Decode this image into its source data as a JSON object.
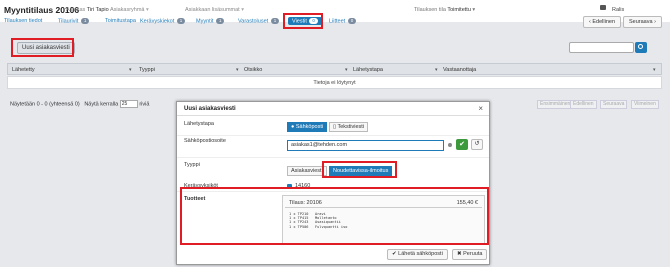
{
  "header": {
    "title": "Myyntitilaus 20106",
    "customer_label": "Asiakas",
    "customer_value": "Tiri Tapio",
    "customer_suffix": "Asiakasryhmä",
    "extra_label": "Asiakkaan lisäsummat",
    "status_label": "Tilauksen tila",
    "status_value": "Toimitettu",
    "user_label": "Ralis",
    "prev_button": "Edellinen",
    "next_button": "Seuraava"
  },
  "tabs": [
    {
      "label": "Tilauksen tiedot"
    },
    {
      "label": "Tilaurivit",
      "badge": "1"
    },
    {
      "label": "Toimitustapa"
    },
    {
      "label": "Kerävyskiekot",
      "badge": "1"
    },
    {
      "label": "Myyntit",
      "badge": "1"
    },
    {
      "label": "Varastoluset",
      "badge": "1"
    },
    {
      "label": "Viestit",
      "badge": "0"
    },
    {
      "label": "Liitteet",
      "badge": "0"
    }
  ],
  "main": {
    "new_message_button": "Uusi asiakasviesti",
    "columns": [
      "Lähetetty",
      "Tyyppi",
      "Otsikko",
      "Lähetystapa",
      "Vastaanottaja"
    ],
    "empty_text": "Tietoja ei löytynyt",
    "pager_text": "Näytetään 0 - 0 (yhteensä 0)",
    "per_page_label": "Näytä kerralla",
    "per_page_value": "25",
    "per_page_suffix": "riviä",
    "pager_buttons": [
      "Ensimmäinen",
      "Edellinen",
      "Seuraava",
      "Viimeinen"
    ]
  },
  "modal": {
    "title": "Uusi asiakasviesti",
    "close": "×",
    "send_method_label": "Lähetystapa",
    "send_methods": [
      "Sähköposti",
      "Tekstiviesti"
    ],
    "email_label": "Sähköpostiosoite",
    "email_value": "asiakas1@tehden.com",
    "type_label": "Tyyppi",
    "types": [
      "Asiakasviesti",
      "Noudettavissa-ilmoitus"
    ],
    "pickup_label": "Keräysyksiköt",
    "pickup_value": "14160",
    "products_label": "Tuotteet",
    "order_label": "Tilaus: 20106",
    "order_total": "155,40 €",
    "product_lines": [
      "1 x TP210   Aravi",
      "1 x TP415   Molletanto",
      "1 x TP243   Asasiquantii",
      "1 x TP506   Fulvquantti iso"
    ],
    "send_button": "Lähetä sähköposti",
    "cancel_button": "Peruuta"
  },
  "colors": {
    "accent": "#1f7ab8",
    "highlight": "#e01d24",
    "success": "#3c9a3c"
  }
}
